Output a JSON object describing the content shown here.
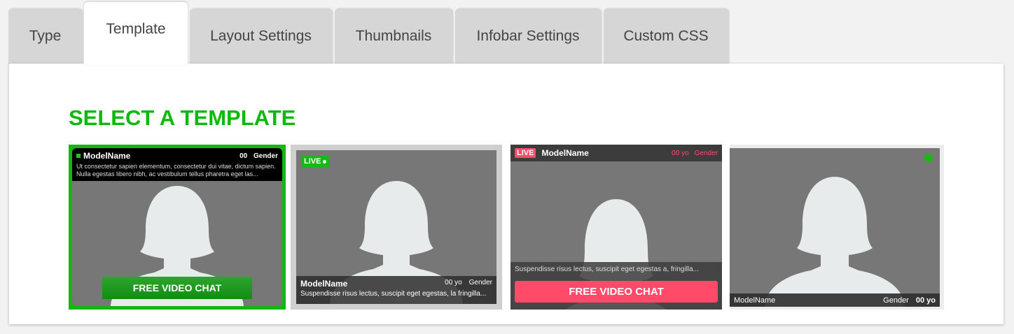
{
  "tabs": [
    {
      "label": "Type"
    },
    {
      "label": "Template"
    },
    {
      "label": "Layout Settings"
    },
    {
      "label": "Thumbnails"
    },
    {
      "label": "Infobar Settings"
    },
    {
      "label": "Custom CSS"
    }
  ],
  "active_tab": "Template",
  "heading": "SELECT A TEMPLATE",
  "colors": {
    "accent_green": "#0cb90c",
    "accent_pink": "#ff4a6a",
    "tab_inactive": "#d6d6d6",
    "placeholder_gray": "#777777",
    "silhouette": "#e7ebec"
  },
  "templates": [
    {
      "selected": true,
      "name": "ModelName",
      "age": "00",
      "gender": "Gender",
      "description": "Ut consectetur sapien elementum, consectetur dui vitae, dictum sapien. Nulla egestas libero nibh, ac vestibulum tellus pharetra eget las...",
      "cta": "FREE VIDEO CHAT"
    },
    {
      "selected": false,
      "live": "LIVE",
      "name": "ModelName",
      "age": "00 yo",
      "gender": "Gender",
      "description": "Suspendisse risus lectus, suscipit eget egestas, la fringilla..."
    },
    {
      "selected": false,
      "live": "LIVE",
      "name": "ModelName",
      "age": "00 yo",
      "gender": "Gender",
      "description": "Suspendisse risus lectus, suscipit eget egestas a, fringilla...",
      "cta": "FREE VIDEO CHAT"
    },
    {
      "selected": false,
      "name": "ModelName",
      "gender": "Gender",
      "age": "00 yo"
    }
  ]
}
